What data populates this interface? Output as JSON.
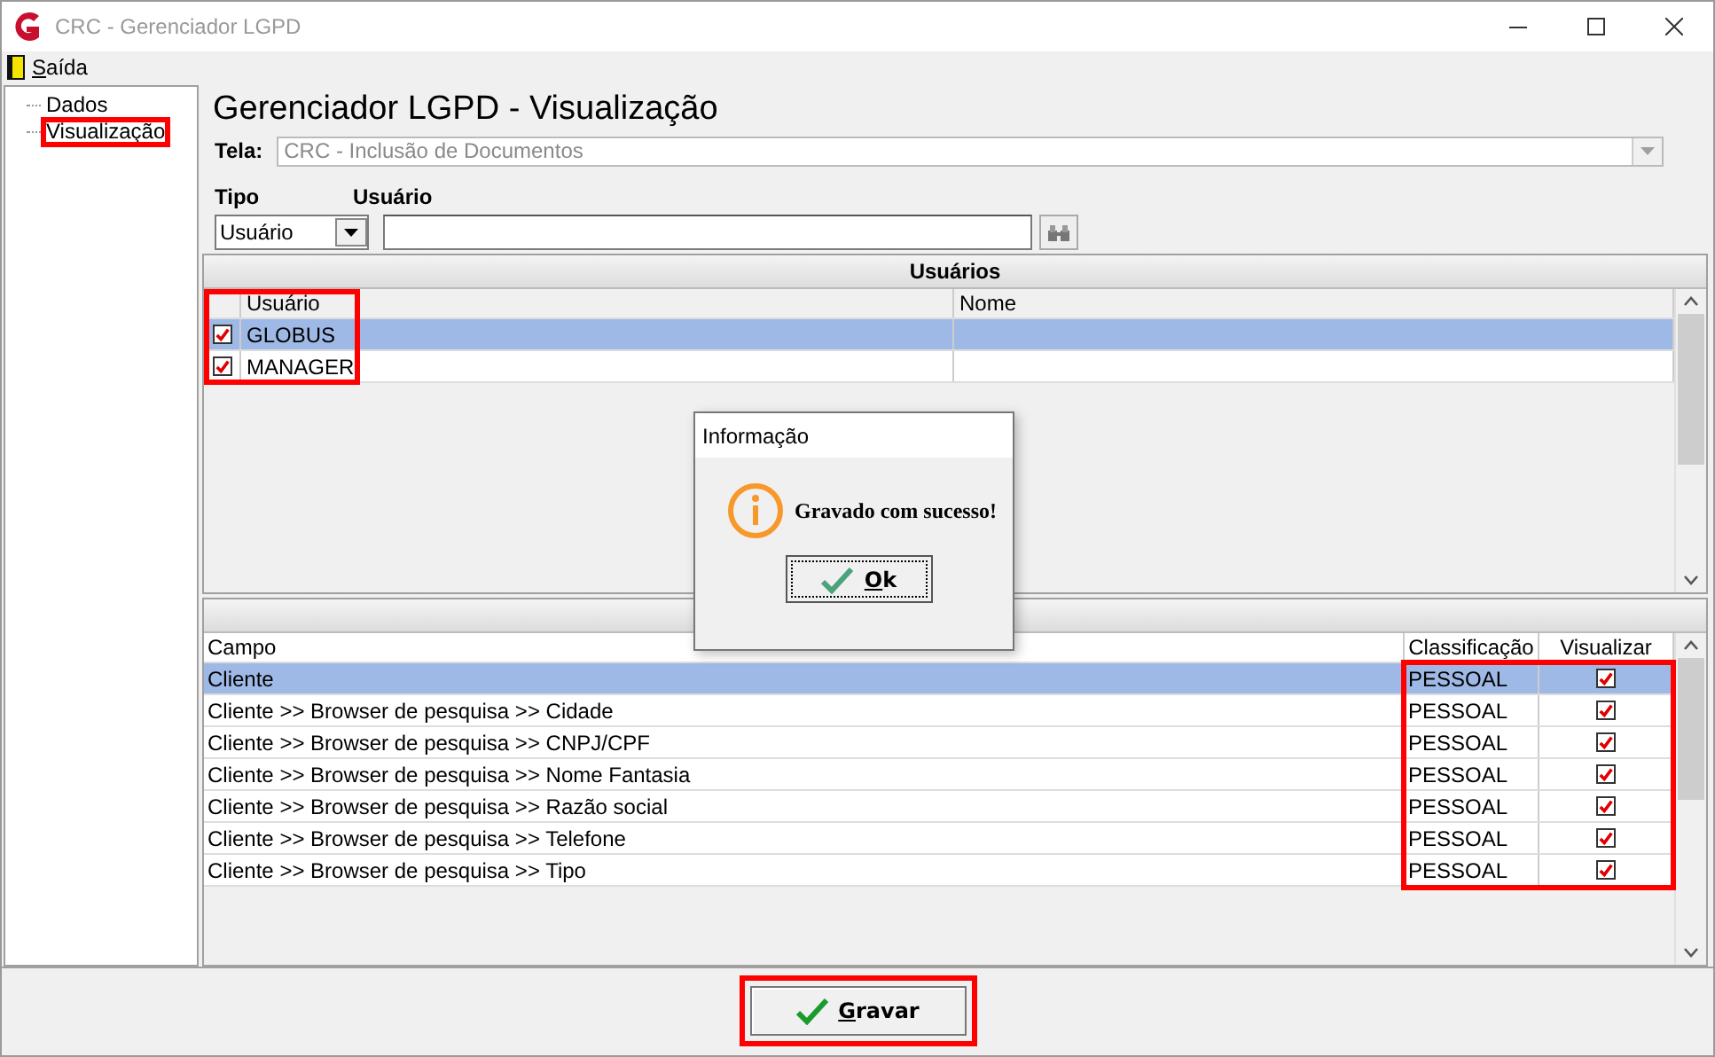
{
  "window": {
    "title": "CRC - Gerenciador LGPD"
  },
  "menu": [
    {
      "label": "Saída"
    }
  ],
  "tree": [
    {
      "label": "Dados",
      "annotated": false
    },
    {
      "label": "Visualização",
      "annotated": true
    }
  ],
  "heading": "Gerenciador LGPD - Visualização",
  "tela": {
    "label": "Tela:",
    "value": "CRC - Inclusão de Documentos",
    "disabled": true
  },
  "tipo": {
    "label": "Tipo",
    "value": "Usuário"
  },
  "usuario": {
    "label": "Usuário"
  },
  "users": {
    "title": "Usuários",
    "columns": [
      "Usuário",
      "Nome"
    ],
    "annotated": true,
    "rows": [
      {
        "checked": true,
        "usuario": "GLOBUS",
        "selected": true
      },
      {
        "checked": true,
        "usuario": "MANAGER",
        "selected": false
      }
    ]
  },
  "fields": {
    "columns": [
      "Campo",
      "Classificação",
      "Visualizar"
    ],
    "annotated": true,
    "rows": [
      {
        "campo": "Cliente",
        "classificacao": "PESSOAL",
        "visualizar": true,
        "selected": true
      },
      {
        "campo": "Cliente >> Browser de pesquisa >> Cidade",
        "classificacao": "PESSOAL",
        "visualizar": true,
        "selected": false
      },
      {
        "campo": "Cliente >> Browser de pesquisa >> CNPJ/CPF",
        "classificacao": "PESSOAL",
        "visualizar": true,
        "selected": false
      },
      {
        "campo": "Cliente >> Browser de pesquisa >> Nome Fantasia",
        "classificacao": "PESSOAL",
        "visualizar": true,
        "selected": false
      },
      {
        "campo": "Cliente >> Browser de pesquisa >> Razão social",
        "classificacao": "PESSOAL",
        "visualizar": true,
        "selected": false
      },
      {
        "campo": "Cliente >> Browser de pesquisa >> Telefone",
        "classificacao": "PESSOAL",
        "visualizar": true,
        "selected": false
      },
      {
        "campo": "Cliente >> Browser de pesquisa >> Tipo",
        "classificacao": "PESSOAL",
        "visualizar": true,
        "selected": false
      }
    ]
  },
  "dialog": {
    "title": "Informação",
    "message": "Gravado com sucesso!",
    "button": {
      "label": "Ok"
    }
  },
  "save_button": {
    "label": "Gravar",
    "annotated": true
  }
}
